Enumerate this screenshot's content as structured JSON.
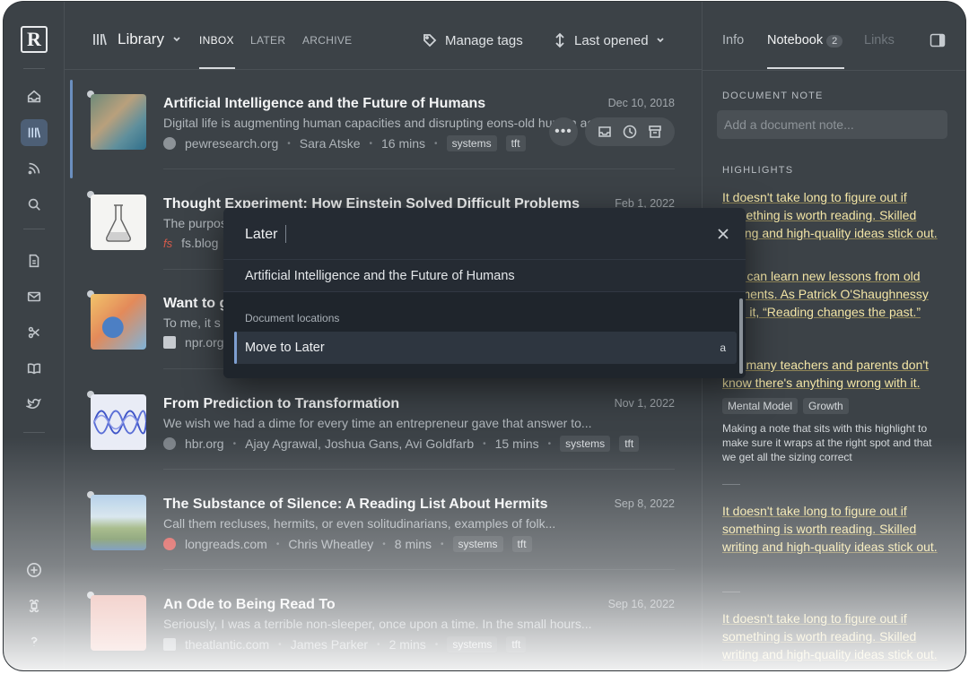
{
  "app": {
    "logo_letter": "R"
  },
  "header": {
    "library_label": "Library",
    "tabs": [
      "INBOX",
      "LATER",
      "ARCHIVE"
    ],
    "manage_tags": "Manage tags",
    "sort_label": "Last opened"
  },
  "documents": [
    {
      "title": "Artificial Intelligence and the Future of Humans",
      "date": "Dec 10, 2018",
      "description": "Digital life is augmenting human capacities and disrupting eons-old human activities",
      "site": "pewresearch.org",
      "author": "Sara Atske",
      "read_time": "16 mins",
      "tags": [
        "systems",
        "tft"
      ]
    },
    {
      "title": "Thought Experiment: How Einstein Solved Difficult Problems",
      "date": "Feb 1, 2022",
      "description": "The purpose",
      "site": "fs.blog",
      "author": "",
      "read_time": "",
      "tags": []
    },
    {
      "title": "Want to g",
      "date": "",
      "description": "To me, it s",
      "site": "npr.org",
      "author": "",
      "read_time": "",
      "tags": []
    },
    {
      "title": "From Prediction to Transformation",
      "date": "Nov 1, 2022",
      "description": "We wish we had a dime for every time an entrepreneur gave that answer to...",
      "site": "hbr.org",
      "author": "Ajay Agrawal, Joshua Gans, Avi Goldfarb",
      "read_time": "15 mins",
      "tags": [
        "systems",
        "tft"
      ]
    },
    {
      "title": "The Substance of Silence: A Reading List About Hermits",
      "date": "Sep 8, 2022",
      "description": "Call them recluses, hermits, or even solitudinarians, examples of folk...",
      "site": "longreads.com",
      "author": "Chris Wheatley",
      "read_time": "8 mins",
      "tags": [
        "systems",
        "tft"
      ]
    },
    {
      "title": "An Ode to Being Read To",
      "date": "Sep 16, 2022",
      "description": "Seriously, I was a terrible non-sleeper, once upon a time. In the small hours...",
      "site": "theatlantic.com",
      "author": "James Parker",
      "read_time": "2 mins",
      "tags": [
        "systems",
        "tft"
      ]
    }
  ],
  "right_panel": {
    "tabs": {
      "info": "Info",
      "notebook": "Notebook",
      "notebook_count": "2",
      "links": "Links"
    },
    "document_note_label": "DOCUMENT NOTE",
    "document_note_placeholder": "Add a document note...",
    "highlights_label": "HIGHLIGHTS",
    "highlights": [
      "It doesn't take long to figure out if something is worth reading. Skilled writing and high-quality ideas stick out.",
      "You can learn new lessons from old moments. As Patrick O'Shaughnessy puts it, “Reading changes the past.”",
      "Too many teachers and parents don't know there's anything wrong with it.",
      "It doesn't take long to figure out if something is worth reading. Skilled writing and high-quality ideas stick out.",
      "It doesn't take long to figure out if something is worth reading. Skilled writing and high-quality ideas stick out."
    ],
    "highlight_tags": [
      "Mental Model",
      "Growth"
    ],
    "highlight_note": "Making a note that sits with this highlight to make sure it wraps at the right spot and that we get all the sizing correct"
  },
  "palette": {
    "query": "Later",
    "document_title": "Artificial Intelligence and the Future of Humans",
    "section_label": "Document locations",
    "item_label": "Move to Later",
    "item_shortcut": "a"
  }
}
